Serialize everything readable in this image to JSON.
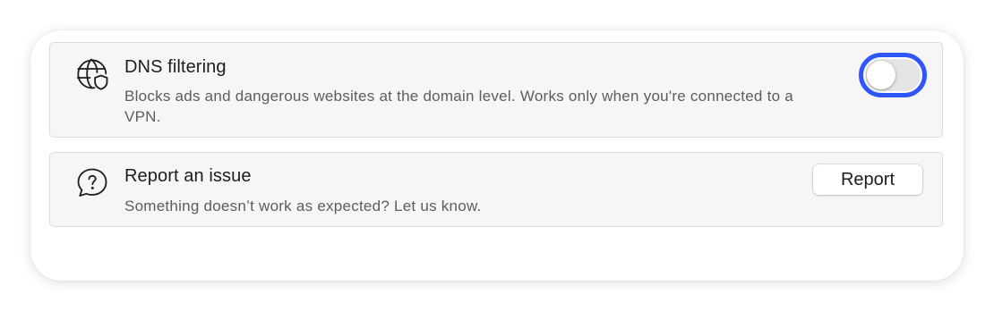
{
  "settings": {
    "dns_filtering": {
      "icon": "globe-shield-icon",
      "title": "DNS filtering",
      "description": "Blocks ads and dangerous websites at the domain level. Works only when you're connected to a VPN.",
      "enabled": false,
      "focus_ring_color": "#2f55ff"
    },
    "report_issue": {
      "icon": "chat-question-icon",
      "title": "Report an issue",
      "description": "Something doesn’t work as expected? Let us know.",
      "button_label": "Report"
    }
  }
}
